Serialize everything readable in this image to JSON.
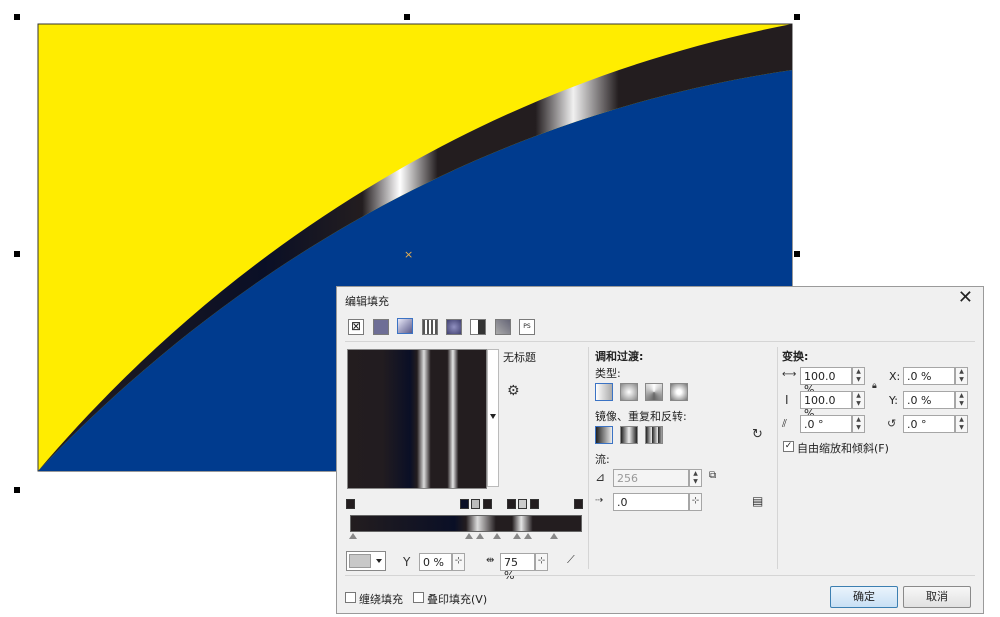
{
  "dialog": {
    "title": "编辑填充",
    "fill_name": "无标题",
    "blend": {
      "heading": "调和过渡:",
      "type_label": "类型:",
      "mirror_label": "镜像、重复和反转:",
      "flow_label": "流:",
      "steps_value": "256",
      "accel_value": ".0"
    },
    "transform": {
      "heading": "变换:",
      "width_value": "100.0 %",
      "height_value": "100.0 %",
      "x_label": "X:",
      "x_value": ".0 %",
      "y_label": "Y:",
      "y_value": ".0 %",
      "skew_value": ".0 °",
      "rotate_value": ".0 °",
      "free_scale_label": "自由缩放和倾斜(F)",
      "free_scale_checked": true
    },
    "node": {
      "transparency_value": "0 %",
      "position_value": "75 %"
    },
    "footer": {
      "wrap_label": "缠绕填充",
      "overprint_label": "叠印填充(V)",
      "ok_label": "确定",
      "cancel_label": "取消"
    }
  },
  "colors": {
    "yellow": "#ffed00",
    "blue": "#003b8e",
    "dark": "#231d1f",
    "accent": "#3b73c4"
  },
  "icons": [
    "close-icon",
    "no-fill-icon",
    "uniform-fill-icon",
    "fountain-fill-icon",
    "vector-pattern-icon",
    "bitmap-pattern-icon",
    "two-color-pattern-icon",
    "texture-fill-icon",
    "postscript-fill-icon",
    "swap-icon",
    "settings-icon",
    "lock-icon"
  ]
}
